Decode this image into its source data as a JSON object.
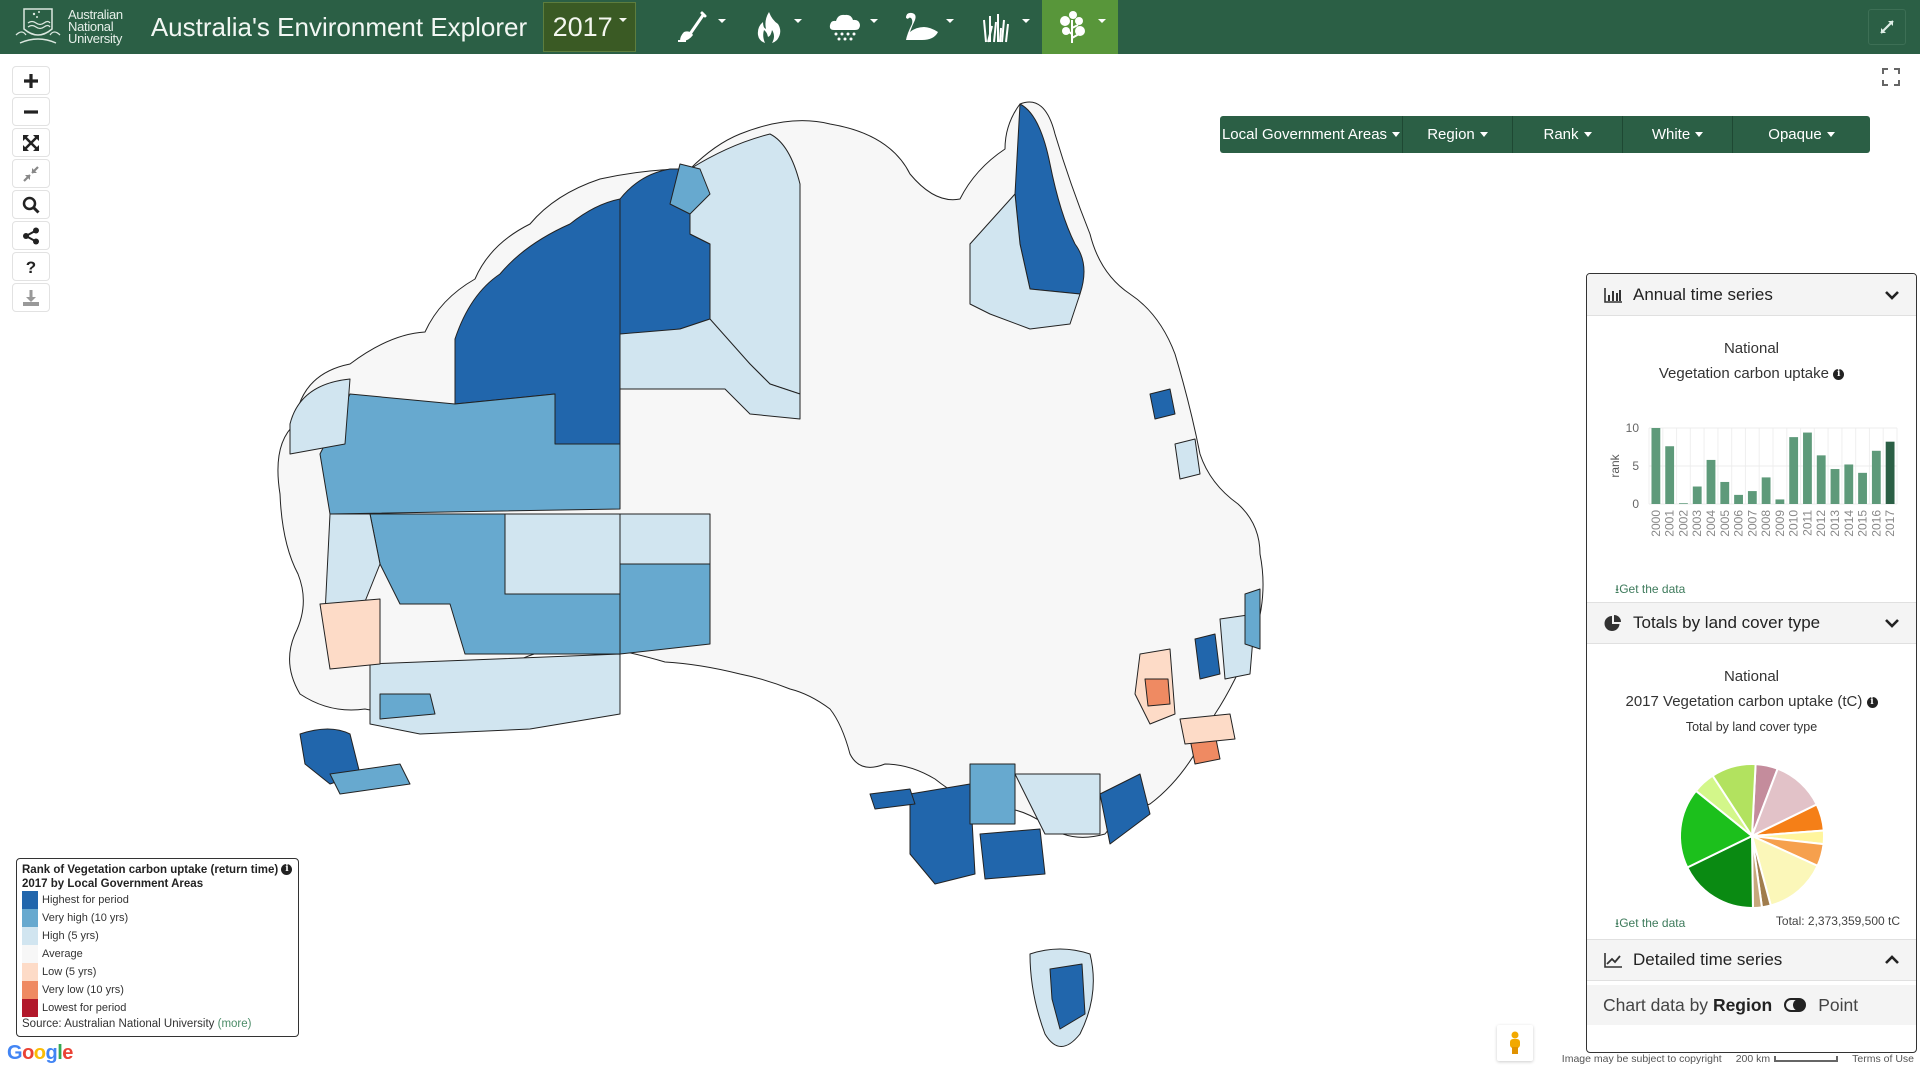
{
  "header": {
    "logo_text": [
      "Australian",
      "National",
      "University"
    ],
    "title": "Australia's Environment Explorer",
    "year": "2017",
    "theme_buttons": [
      {
        "icon": "shovel-icon",
        "label": "Soil"
      },
      {
        "icon": "fire-icon",
        "label": "Fire"
      },
      {
        "icon": "rain-cloud-icon",
        "label": "Weather"
      },
      {
        "icon": "swan-icon",
        "label": "Water"
      },
      {
        "icon": "grass-icon",
        "label": "Landscape"
      },
      {
        "icon": "tree-icon",
        "label": "Vegetation",
        "active": true
      }
    ],
    "expand_icon": "expand-arrows-icon"
  },
  "map_tools": [
    {
      "icon": "zoom-in-icon",
      "label": "Zoom in"
    },
    {
      "icon": "zoom-out-icon",
      "label": "Zoom out"
    },
    {
      "icon": "zoom-extent-icon",
      "label": "Full extent"
    },
    {
      "icon": "collapse-icon",
      "label": "Reduce"
    },
    {
      "icon": "search-icon",
      "label": "Search"
    },
    {
      "icon": "share-icon",
      "label": "Share"
    },
    {
      "icon": "help-icon",
      "label": "Help"
    },
    {
      "icon": "download-icon",
      "label": "Download"
    }
  ],
  "layer_controls": [
    {
      "label": "Local Government Areas"
    },
    {
      "label": "Region"
    },
    {
      "label": "Rank"
    },
    {
      "label": "White"
    },
    {
      "label": "Opaque"
    }
  ],
  "legend": {
    "title_line1": "Rank of Vegetation carbon uptake (return time)",
    "title_line2": "2017 by Local Government Areas",
    "items": [
      {
        "label": "Highest for period",
        "color": "#2166ac"
      },
      {
        "label": "Very high (10 yrs)",
        "color": "#67a9cf"
      },
      {
        "label": "High (5 yrs)",
        "color": "#d1e5f0"
      },
      {
        "label": "Average",
        "color": "#f7f7f7"
      },
      {
        "label": "Low (5 yrs)",
        "color": "#fddbc7"
      },
      {
        "label": "Very low (10 yrs)",
        "color": "#ef8a62"
      },
      {
        "label": "Lowest for period",
        "color": "#b2182b"
      }
    ],
    "source_prefix": "Source:  Australian National University",
    "source_link": "(more)"
  },
  "map_footer": {
    "google": "Google",
    "copyright": "Image may be subject to copyright",
    "scale": "200 km",
    "terms": "Terms of Use"
  },
  "side_panel": {
    "annual": {
      "title": "Annual time series",
      "region": "National",
      "subtitle": "Vegetation carbon uptake",
      "get_data": "Get the data"
    },
    "totals": {
      "title": "Totals by land cover type",
      "region": "National",
      "subtitle": "2017 Vegetation carbon uptake (tC)",
      "chart_title": "Total by land cover type",
      "get_data": "Get the data",
      "total": "Total: 2,373,359,500 tC"
    },
    "detailed": {
      "title": "Detailed time series",
      "chart_by_prefix": "Chart data by",
      "chart_by_region": "Region",
      "chart_by_point": "Point"
    }
  },
  "chart_data": [
    {
      "type": "bar",
      "title": "Vegetation carbon uptake",
      "subtitle": "National",
      "xlabel": "",
      "ylabel": "rank",
      "ylim": [
        0,
        10
      ],
      "yticks": [
        0,
        5,
        10
      ],
      "grid": true,
      "categories": [
        "2000",
        "2001",
        "2002",
        "2003",
        "2004",
        "2005",
        "2006",
        "2007",
        "2008",
        "2009",
        "2010",
        "2011",
        "2012",
        "2013",
        "2014",
        "2015",
        "2016",
        "2017"
      ],
      "values": [
        10,
        7.6,
        0.1,
        2.3,
        5.8,
        2.9,
        1.2,
        1.7,
        3.5,
        0.6,
        8.8,
        9.4,
        6.4,
        4.6,
        5.2,
        4.1,
        7.0,
        8.2
      ],
      "highlight": "2017",
      "bar_color": "#5e9a7a",
      "highlight_color": "#2b5f45"
    },
    {
      "type": "pie",
      "title": "Total by land cover type",
      "subtitle": "2017 Vegetation carbon uptake (tC)",
      "total": 2373359500,
      "slices": [
        {
          "share": 5,
          "color": "#c48c9c"
        },
        {
          "share": 12,
          "color": "#e2c2c8"
        },
        {
          "share": 6,
          "color": "#f57f17"
        },
        {
          "share": 3,
          "color": "#fff59d"
        },
        {
          "share": 5,
          "color": "#f6a04d"
        },
        {
          "share": 14,
          "color": "#fbf7b9"
        },
        {
          "share": 2,
          "color": "#a07c4c"
        },
        {
          "share": 2,
          "color": "#c7a87c"
        },
        {
          "share": 18,
          "color": "#0a8a12"
        },
        {
          "share": 18,
          "color": "#1cc01c"
        },
        {
          "share": 5,
          "color": "#d3f78a"
        },
        {
          "share": 10,
          "color": "#b2e25f"
        }
      ]
    }
  ]
}
